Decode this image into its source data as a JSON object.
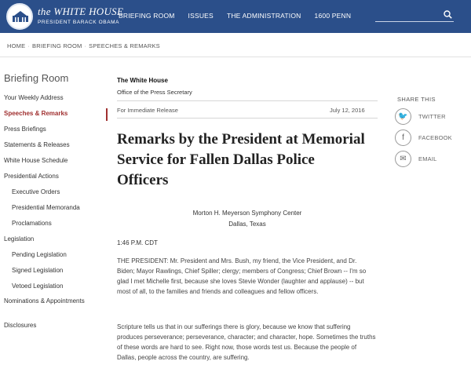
{
  "header": {
    "brand_line1": "the WHITE HOUSE",
    "brand_line2": "PRESIDENT BARACK OBAMA",
    "nav": [
      "BRIEFING ROOM",
      "ISSUES",
      "THE ADMINISTRATION",
      "1600 PENN"
    ],
    "search_icon": "search-icon",
    "bg_color": "#2b4f8a"
  },
  "breadcrumb": [
    "HOME",
    "BRIEFING ROOM",
    "SPEECHES & REMARKS"
  ],
  "sidebar": {
    "title": "Briefing Room",
    "items": [
      {
        "label": "Your Weekly Address",
        "sub": false,
        "active": false
      },
      {
        "label": "Speeches & Remarks",
        "sub": false,
        "active": true
      },
      {
        "label": "Press Briefings",
        "sub": false,
        "active": false
      },
      {
        "label": "Statements & Releases",
        "sub": false,
        "active": false
      },
      {
        "label": "White House Schedule",
        "sub": false,
        "active": false
      },
      {
        "label": "Presidential Actions",
        "sub": false,
        "active": false
      },
      {
        "label": "Executive Orders",
        "sub": true,
        "active": false
      },
      {
        "label": "Presidential Memoranda",
        "sub": true,
        "active": false
      },
      {
        "label": "Proclamations",
        "sub": true,
        "active": false
      },
      {
        "label": "Legislation",
        "sub": false,
        "active": false
      },
      {
        "label": "Pending Legislation",
        "sub": true,
        "active": false
      },
      {
        "label": "Signed Legislation",
        "sub": true,
        "active": false
      },
      {
        "label": "Vetoed Legislation",
        "sub": true,
        "active": false
      },
      {
        "label": "Nominations & Appointments",
        "sub": false,
        "active": false
      },
      {
        "label": "Disclosures",
        "sub": false,
        "active": false
      }
    ],
    "accent_color": "#a03030"
  },
  "article": {
    "from": "The White House",
    "office": "Office of the Press Secretary",
    "release": "For Immediate Release",
    "date": "July 12, 2016",
    "title": "Remarks by the President at Memorial Service for Fallen Dallas Police Officers",
    "venue_line1": "Morton H. Meyerson Symphony Center",
    "venue_line2": "Dallas, Texas",
    "time": "1:46 P.M. CDT",
    "paragraph1": "THE PRESIDENT:  Mr. President and Mrs. Bush, my friend, the Vice President, and Dr. Biden; Mayor Rawlings, Chief Spiller; clergy; members of Congress; Chief Brown -- I'm so glad I met Michelle first, because she loves Stevie Wonder (laughter and applause) -- but most of all, to the families and friends and colleagues and fellow officers.",
    "paragraph2": "Scripture tells us that in our sufferings there is glory, because we know that suffering produces perseverance; perseverance, character; and character, hope. Sometimes the truths of these words are hard to see.  Right now, those words test us.  Because the people of Dallas, people across the country, are suffering."
  },
  "share": {
    "title": "SHARE THIS",
    "items": [
      {
        "label": "TWITTER",
        "icon": "twitter-icon",
        "glyph": "🐦"
      },
      {
        "label": "FACEBOOK",
        "icon": "facebook-icon",
        "glyph": "f"
      },
      {
        "label": "EMAIL",
        "icon": "email-icon",
        "glyph": "✉"
      }
    ]
  }
}
